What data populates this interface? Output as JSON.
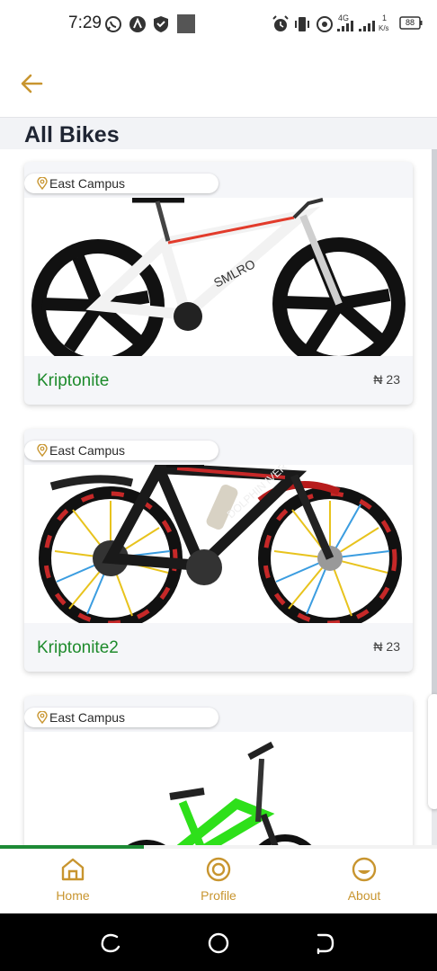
{
  "status_bar": {
    "time": "7:29",
    "network": "4G",
    "speed_value": "1",
    "speed_unit": "K/s",
    "battery": "88"
  },
  "header": {
    "back_icon": "arrow-left-icon",
    "title": "All Bikes",
    "accent_color": "#c8952f"
  },
  "bikes": [
    {
      "location": "East Campus",
      "name": "Kriptonite",
      "price": "₦ 23",
      "image": "white-red-mountain-bike"
    },
    {
      "location": "East Campus",
      "name": "Kriptonite2",
      "price": "₦ 23",
      "image": "black-red-mountain-bike"
    },
    {
      "location": "East Campus",
      "name": "",
      "price": "",
      "image": "green-kids-bike"
    }
  ],
  "progress": {
    "fraction": 0.33,
    "color": "#1d8a35"
  },
  "bottom_nav": {
    "items": [
      {
        "label": "Home",
        "icon": "home-icon"
      },
      {
        "label": "Profile",
        "icon": "profile-icon"
      },
      {
        "label": "About",
        "icon": "about-icon"
      }
    ]
  },
  "system_nav": {
    "buttons": [
      "recents-icon",
      "home-circle-icon",
      "back-icon"
    ]
  }
}
